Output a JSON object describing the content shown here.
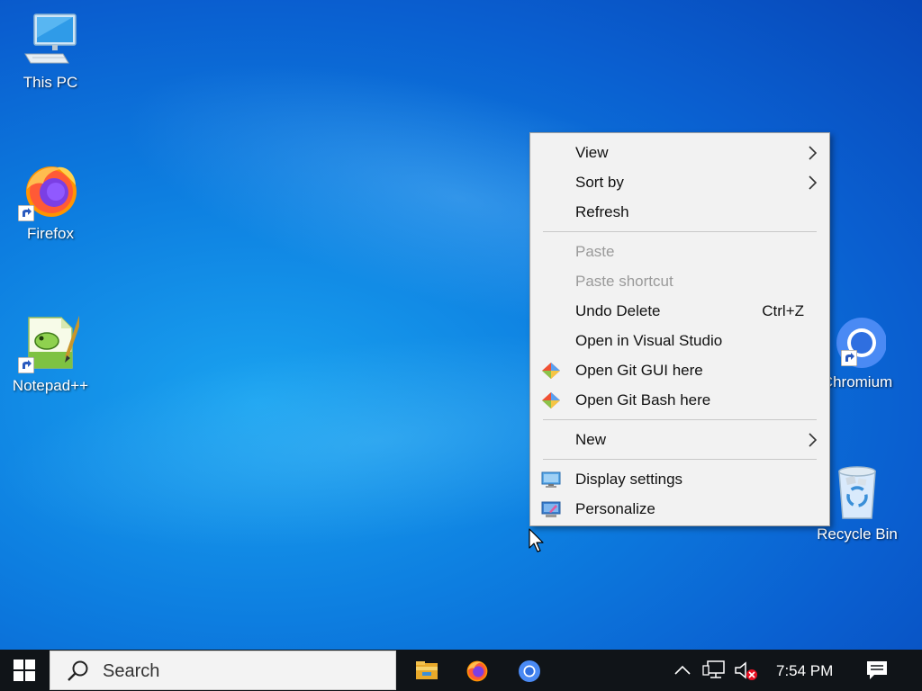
{
  "desktop": {
    "icons": [
      {
        "label": "This PC",
        "icon": "this-pc-icon"
      },
      {
        "label": "Firefox",
        "icon": "firefox-icon"
      },
      {
        "label": "Notepad++",
        "icon": "notepadpp-icon"
      },
      {
        "label": "Chromium",
        "icon": "chromium-icon"
      },
      {
        "label": "Recycle Bin",
        "icon": "recycle-bin-icon"
      }
    ]
  },
  "context_menu": {
    "view": "View",
    "sort_by": "Sort by",
    "refresh": "Refresh",
    "paste": "Paste",
    "paste_shortcut": "Paste shortcut",
    "undo_delete": "Undo Delete",
    "undo_delete_shortcut": "Ctrl+Z",
    "open_in_visual_studio": "Open in Visual Studio",
    "open_git_gui": "Open Git GUI here",
    "open_git_bash": "Open Git Bash here",
    "new": "New",
    "display_settings": "Display settings",
    "personalize": "Personalize"
  },
  "taskbar": {
    "search_placeholder": "Search",
    "clock": "7:54 PM",
    "apps": [
      "file-explorer-icon",
      "firefox-icon",
      "chromium-icon"
    ]
  },
  "colors": {
    "desktop_blue": "#0a5fd0",
    "taskbar": "#101418",
    "menu_bg": "#f2f2f2",
    "disabled_text": "#9a9a9a"
  }
}
